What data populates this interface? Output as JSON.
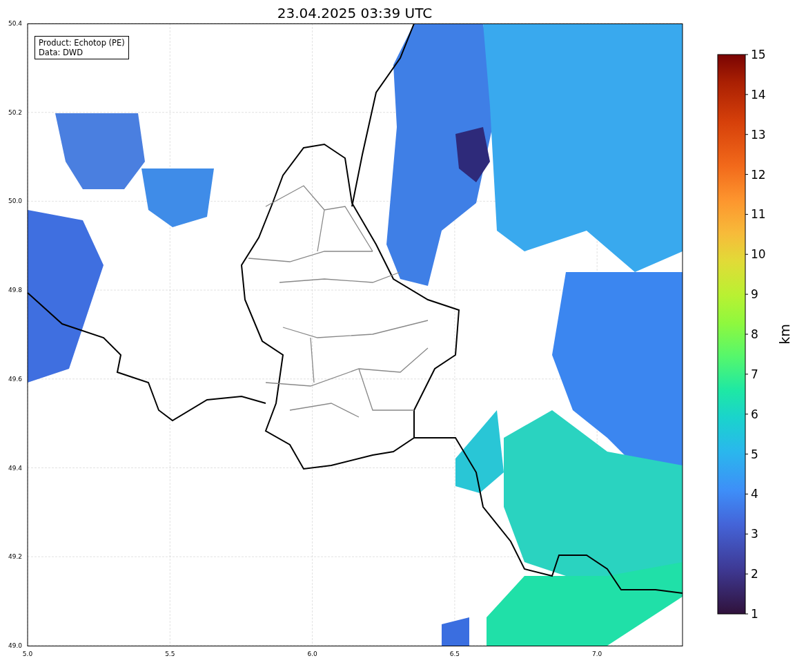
{
  "title": "23.04.2025 03:39 UTC",
  "info_box": [
    "Product: Echotop (PE)",
    "Data: DWD"
  ],
  "x_ticks": [
    "5.0",
    "5.5",
    "6.0",
    "6.5",
    "7.0"
  ],
  "y_ticks": [
    "50.4",
    "50.2",
    "50.0",
    "49.8",
    "49.6",
    "49.4",
    "49.2",
    "49.0"
  ],
  "colorbar": {
    "label": "km",
    "ticks": [
      "15",
      "14",
      "13",
      "12",
      "11",
      "10",
      "9",
      "8",
      "7",
      "6",
      "5",
      "4",
      "3",
      "2",
      "1"
    ]
  }
}
